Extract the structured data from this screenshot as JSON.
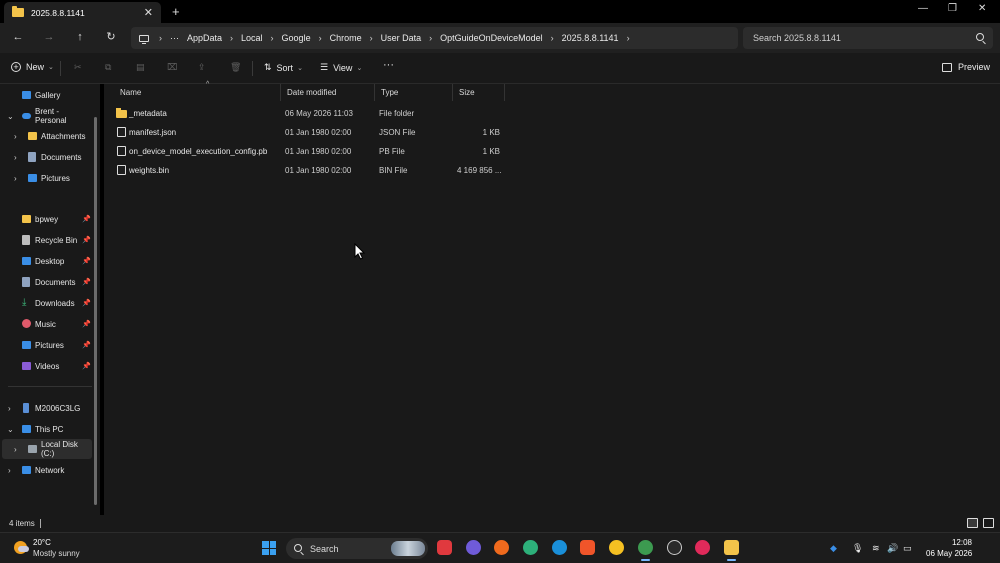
{
  "window": {
    "tab_title": "2025.8.8.1141",
    "tab_close": "✕",
    "new_tab": "+",
    "minimize": "—",
    "maximize": "❐",
    "close": "✕"
  },
  "nav": {
    "back": "←",
    "forward": "→",
    "up": "↑",
    "refresh": "↻",
    "ellipsis": "···",
    "breadcrumbs": [
      "AppData",
      "Local",
      "Google",
      "Chrome",
      "User Data",
      "OptGuideOnDeviceModel",
      "2025.8.8.1141"
    ],
    "search_placeholder": "Search 2025.8.8.1141"
  },
  "toolbar": {
    "new_label": "New",
    "sort_label": "Sort",
    "view_label": "View",
    "more_label": "···",
    "preview_label": "Preview"
  },
  "sidebar": {
    "gallery": "Gallery",
    "onedrive": "Brent - Personal",
    "onedrive_children": [
      "Attachments",
      "Documents",
      "Pictures"
    ],
    "quick_access": [
      "bpwey",
      "Recycle Bin",
      "Desktop",
      "Documents",
      "Downloads",
      "Music",
      "Pictures",
      "Videos"
    ],
    "devices": [
      "M2006C3LG",
      "This PC",
      "Local Disk (C:)",
      "Network"
    ]
  },
  "columns": {
    "name": "Name",
    "date": "Date modified",
    "type": "Type",
    "size": "Size"
  },
  "files": [
    {
      "name": "_metadata",
      "date": "06 May 2026 11:03",
      "type": "File folder",
      "size": "",
      "kind": "folder"
    },
    {
      "name": "manifest.json",
      "date": "01 Jan 1980 02:00",
      "type": "JSON File",
      "size": "1 KB",
      "kind": "file"
    },
    {
      "name": "on_device_model_execution_config.pb",
      "date": "01 Jan 1980 02:00",
      "type": "PB File",
      "size": "1 KB",
      "kind": "file"
    },
    {
      "name": "weights.bin",
      "date": "01 Jan 1980 02:00",
      "type": "BIN File",
      "size": "4 169 856 ...",
      "kind": "file"
    }
  ],
  "status": {
    "item_count": "4 items"
  },
  "taskbar": {
    "temperature": "20°C",
    "weather": "Mostly sunny",
    "search_label": "Search",
    "time": "12:08",
    "date": "06 May 2026"
  }
}
